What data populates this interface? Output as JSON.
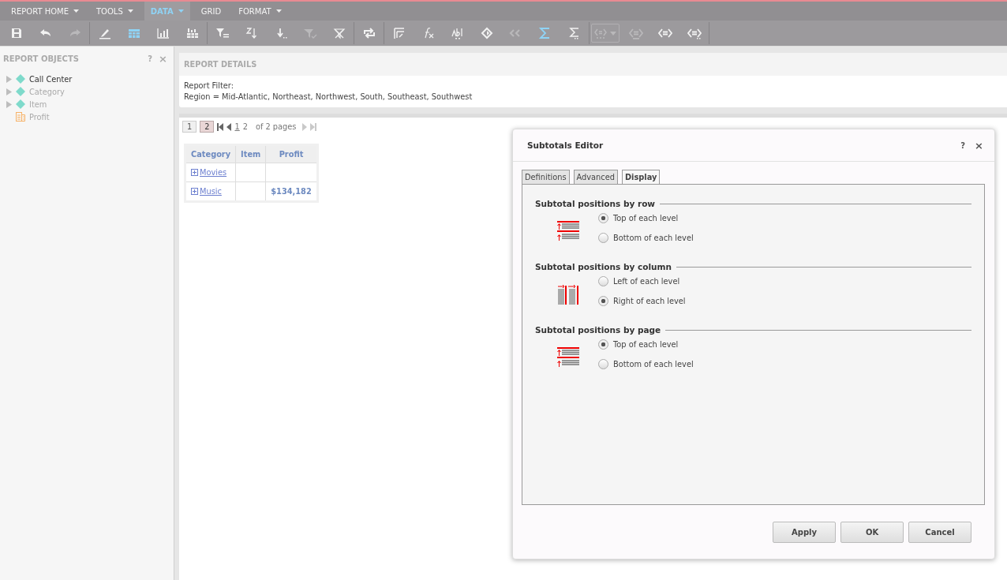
{
  "menu": [
    {
      "label": "REPORT HOME",
      "selected": false,
      "dropdown": true
    },
    {
      "label": "TOOLS",
      "selected": false,
      "dropdown": true
    },
    {
      "label": "DATA",
      "selected": true,
      "dropdown": true
    },
    {
      "label": "GRID",
      "selected": false,
      "dropdown": false
    },
    {
      "label": "FORMAT",
      "selected": false,
      "dropdown": true
    }
  ],
  "toolbar": [
    {
      "selected": false,
      "disabled": false
    },
    {
      "selected": false,
      "disabled": false
    },
    {
      "selected": false,
      "disabled": true
    },
    {
      "selected": false,
      "disabled": false
    },
    {
      "selected": true,
      "disabled": false
    },
    {
      "selected": false,
      "disabled": false
    },
    {
      "selected": false,
      "disabled": false
    },
    {
      "selected": false,
      "disabled": false
    },
    {
      "selected": false,
      "disabled": false
    },
    {
      "selected": false,
      "disabled": false
    },
    {
      "selected": false,
      "disabled": true
    },
    {
      "selected": false,
      "disabled": false
    },
    {
      "selected": false,
      "disabled": false
    },
    {
      "selected": false,
      "disabled": false
    },
    {
      "selected": false,
      "disabled": false
    },
    {
      "selected": false,
      "disabled": false
    },
    {
      "selected": false,
      "disabled": false
    },
    {
      "selected": false,
      "disabled": true
    },
    {
      "selected": true,
      "disabled": false
    },
    {
      "selected": false,
      "disabled": false
    },
    {
      "selected": false,
      "disabled": true
    },
    {
      "selected": false,
      "disabled": true
    },
    {
      "selected": false,
      "disabled": false
    },
    {
      "selected": false,
      "disabled": false
    }
  ],
  "sidebar": {
    "title": "REPORT OBJECTS",
    "help": "?",
    "close": "×",
    "items": [
      {
        "label": "Call Center",
        "kind": "attribute",
        "disabled": false
      },
      {
        "label": "Category",
        "kind": "attribute",
        "disabled": true
      },
      {
        "label": "Item",
        "kind": "attribute",
        "disabled": true
      },
      {
        "label": "Profit",
        "kind": "metric",
        "disabled": true
      }
    ]
  },
  "report_details": {
    "title": "REPORT DETAILS",
    "filter_label": "Report Filter:",
    "filter_value": "Region = Mid-Atlantic, Northeast, Northwest, South, Southeast, Southwest"
  },
  "pager": {
    "pages": [
      {
        "label": "1",
        "selected": false
      },
      {
        "label": "2",
        "selected": true
      }
    ],
    "links": [
      {
        "label": "1",
        "selected": false
      },
      {
        "label": "2",
        "selected": true
      }
    ],
    "summary": "of 2 pages"
  },
  "table": {
    "columns": [
      "Category",
      "Item",
      "Profit"
    ],
    "rows": [
      {
        "category": "Movies",
        "item": "",
        "profit": ""
      },
      {
        "category": "Music",
        "item": "",
        "profit": "$134,182"
      }
    ]
  },
  "dialog": {
    "title": "Subtotals Editor",
    "help": "?",
    "close": "×",
    "tabs": [
      {
        "label": "Definitions",
        "selected": false
      },
      {
        "label": "Advanced",
        "selected": false
      },
      {
        "label": "Display",
        "selected": true
      }
    ],
    "sections": [
      {
        "title": "Subtotal positions by row",
        "kind": "row",
        "options": [
          {
            "label": "Top of each level",
            "selected": true
          },
          {
            "label": "Bottom of each level",
            "selected": false
          }
        ]
      },
      {
        "title": "Subtotal positions by column",
        "kind": "column",
        "options": [
          {
            "label": "Left of each level",
            "selected": false
          },
          {
            "label": "Right of each level",
            "selected": true
          }
        ]
      },
      {
        "title": "Subtotal positions by page",
        "kind": "page",
        "options": [
          {
            "label": "Top of each level",
            "selected": true
          },
          {
            "label": "Bottom of each level",
            "selected": false
          }
        ]
      }
    ],
    "buttons": [
      "Apply",
      "OK",
      "Cancel"
    ]
  }
}
